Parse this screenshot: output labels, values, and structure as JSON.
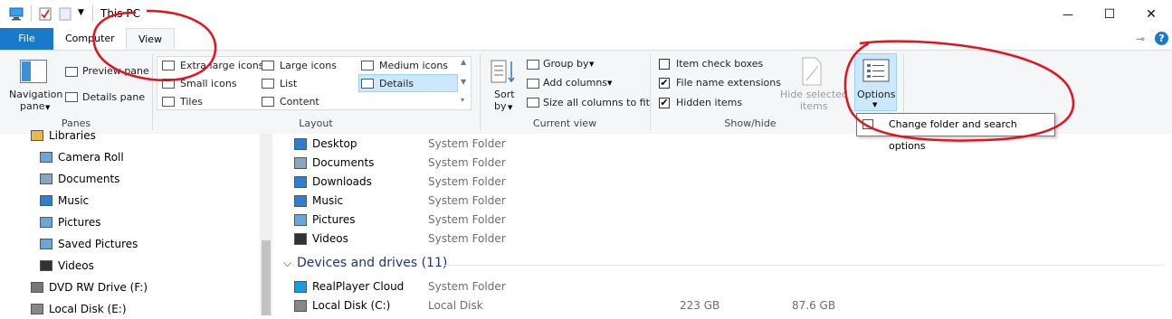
{
  "window": {
    "title": "This PC",
    "minimize": "—",
    "maximize": "☐",
    "close": "✕"
  },
  "tabs": {
    "file": "File",
    "computer": "Computer",
    "view": "View"
  },
  "ribbon": {
    "panes": {
      "navigation_pane": "Navigation",
      "navigation_pane_2": "pane",
      "preview_pane": "Preview pane",
      "details_pane": "Details pane",
      "label": "Panes"
    },
    "layout": {
      "extra_large_icons": "Extra large icons",
      "large_icons": "Large icons",
      "medium_icons": "Medium icons",
      "small_icons": "Small icons",
      "list": "List",
      "details": "Details",
      "tiles": "Tiles",
      "content": "Content",
      "label": "Layout"
    },
    "current_view": {
      "sort_by": "Sort",
      "sort_by_2": "by",
      "group_by": "Group by",
      "add_columns": "Add columns",
      "size_all_columns": "Size all columns to fit",
      "label": "Current view"
    },
    "show_hide": {
      "item_check_boxes": "Item check boxes",
      "file_name_extensions": "File name extensions",
      "hidden_items": "Hidden items",
      "hide_selected_items": "Hide selected",
      "hide_selected_items_2": "items",
      "label": "Show/hide",
      "item_check_boxes_checked": false,
      "file_name_extensions_checked": true,
      "hidden_items_checked": true
    },
    "options": {
      "label": "Options",
      "tooltip": "Change folder and search options"
    }
  },
  "nav_pane": {
    "items": [
      {
        "label": "Libraries",
        "icon": "library-icon"
      },
      {
        "label": "Camera Roll",
        "icon": "folder-pictures-icon"
      },
      {
        "label": "Documents",
        "icon": "folder-documents-icon"
      },
      {
        "label": "Music",
        "icon": "music-icon"
      },
      {
        "label": "Pictures",
        "icon": "folder-pictures-icon"
      },
      {
        "label": "Saved Pictures",
        "icon": "folder-pictures-icon"
      },
      {
        "label": "Videos",
        "icon": "video-icon"
      },
      {
        "label": "DVD RW Drive (F:)",
        "icon": "dvd-drive-icon"
      },
      {
        "label": "Local Disk (E:)",
        "icon": "disk-icon"
      }
    ]
  },
  "content": {
    "folders": [
      {
        "name": "Desktop",
        "type": "System Folder",
        "icon": "desktop-icon"
      },
      {
        "name": "Documents",
        "type": "System Folder",
        "icon": "documents-icon"
      },
      {
        "name": "Downloads",
        "type": "System Folder",
        "icon": "download-icon"
      },
      {
        "name": "Music",
        "type": "System Folder",
        "icon": "music-icon"
      },
      {
        "name": "Pictures",
        "type": "System Folder",
        "icon": "pictures-icon"
      },
      {
        "name": "Videos",
        "type": "System Folder",
        "icon": "video-icon"
      }
    ],
    "devices_header": "Devices and drives (11)",
    "devices": [
      {
        "name": "RealPlayer Cloud",
        "type": "System Folder",
        "total": "",
        "free": "",
        "icon": "cloud-icon"
      },
      {
        "name": "Local Disk (C:)",
        "type": "Local Disk",
        "total": "223 GB",
        "free": "87.6 GB",
        "icon": "disk-icon"
      }
    ]
  },
  "colors": {
    "file_tab": "#1979ca",
    "annotation": "#e8101a",
    "selected_bg": "#cce8ff",
    "group_header": "#1e3287"
  }
}
